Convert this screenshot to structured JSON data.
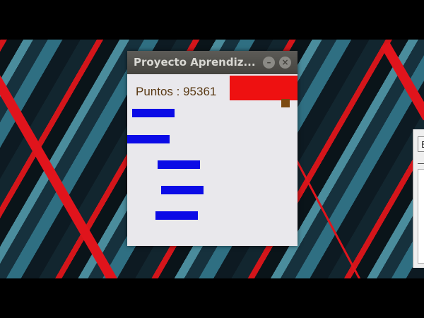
{
  "window": {
    "title": "Proyecto Aprendiz...",
    "minimize_icon": "minimize-icon",
    "close_icon": "close-icon"
  },
  "game": {
    "score_text": "Puntos : 95361",
    "colors": {
      "background": "#e9e8ec",
      "player": "#ee1111",
      "blocks": "#0b0be6",
      "piece": "#7b4a12"
    },
    "block_count": 5
  },
  "side_window": {
    "button_label": "E"
  }
}
